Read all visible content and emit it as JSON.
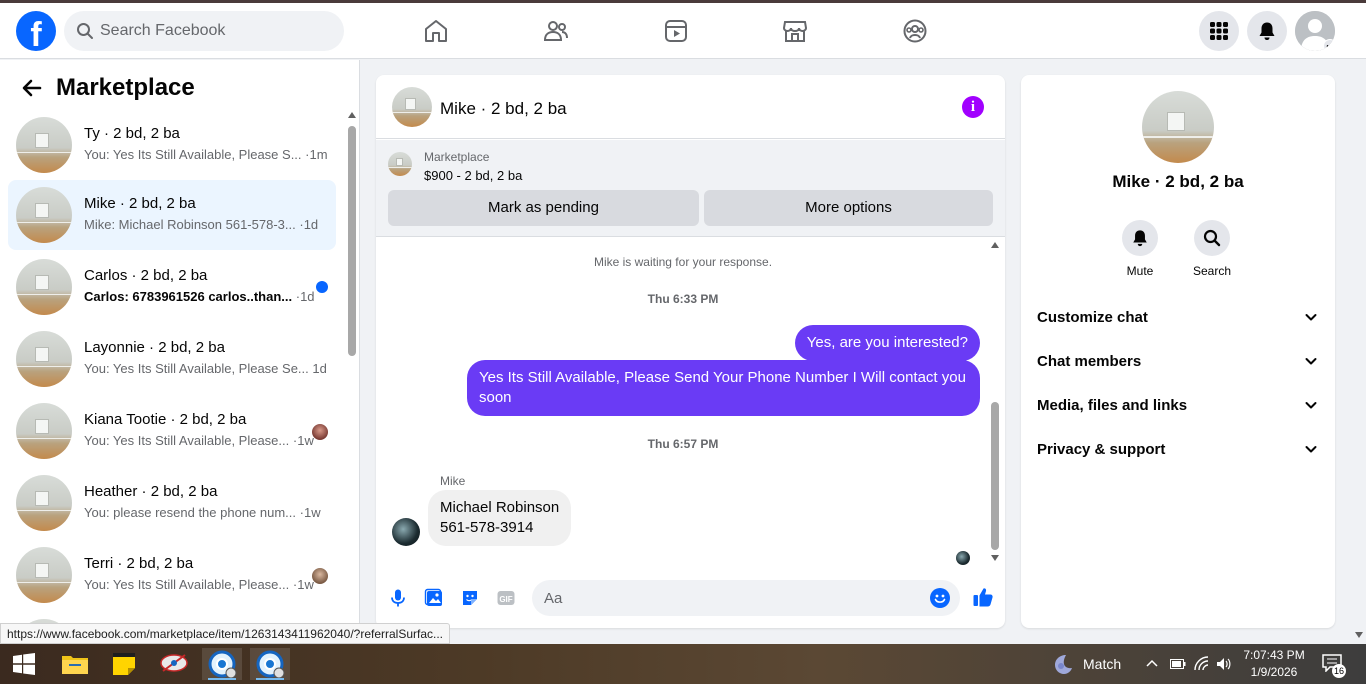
{
  "colors": {
    "brand": "#0866ff",
    "outgoing_bubble": "#6a3bf5",
    "info_accent": "#a100ff",
    "active_row": "#ebf5ff"
  },
  "topbar": {
    "logo_glyph": "f",
    "search_placeholder": "Search Facebook",
    "nav_icons": [
      "home-icon",
      "friends-icon",
      "video-icon",
      "marketplace-icon",
      "groups-icon"
    ],
    "right_icons": [
      "menu-grid-icon",
      "notifications-bell-icon",
      "account-avatar"
    ]
  },
  "sidebar": {
    "title": "Marketplace",
    "conversations": [
      {
        "name": "Ty · 2 bd, 2 ba",
        "preview": "You: Yes Its Still Available, Please S...",
        "time": "·1m",
        "status": "none"
      },
      {
        "name": "Mike · 2 bd, 2 ba",
        "preview": "Mike: Michael Robinson 561-578-3...",
        "time": "·1d",
        "status": "none"
      },
      {
        "name": "Carlos · 2 bd, 2 ba",
        "preview": "Carlos: 6783961526 carlos..than...",
        "time": "·1d",
        "status": "unread-dot"
      },
      {
        "name": "Layonnie · 2 bd, 2 ba",
        "preview": "You: Yes Its Still Available, Please Se...",
        "time": "1d",
        "status": "none"
      },
      {
        "name": "Kiana Tootie · 2 bd, 2 ba",
        "preview": "You: Yes Its Still Available, Please...",
        "time": "·1w",
        "status": "seen-avatar"
      },
      {
        "name": "Heather · 2 bd, 2 ba",
        "preview": "You: please resend the phone num...",
        "time": "·1w",
        "status": "none"
      },
      {
        "name": "Terri · 2 bd, 2 ba",
        "preview": "You: Yes Its Still Available, Please...",
        "time": "·1w",
        "status": "seen-avatar"
      }
    ]
  },
  "chat": {
    "title": "Mike · 2 bd, 2 ba",
    "listing": {
      "label": "Marketplace",
      "price": "$900 - 2 bd, 2 ba",
      "mark_pending": "Mark as pending",
      "more_options": "More options"
    },
    "system_message": "Mike is waiting for your response.",
    "time1": "Thu 6:33 PM",
    "out1": "Yes, are you interested?",
    "out2": "Yes Its Still Available, Please Send Your Phone Number I Will contact you soon",
    "time2": "Thu 6:57 PM",
    "sender_name": "Mike",
    "in1": "Michael Robinson\n561-578-3914",
    "composer_placeholder": "Aa",
    "composer_icons": [
      "microphone-icon",
      "photo-icon",
      "sticker-icon",
      "gif-icon",
      "emoji-icon",
      "thumbs-up-icon"
    ]
  },
  "info_panel": {
    "name": "Mike · 2 bd, 2 ba",
    "mute_label": "Mute",
    "search_label": "Search",
    "sections": [
      "Customize chat",
      "Chat members",
      "Media, files and links",
      "Privacy & support"
    ]
  },
  "status_url": "https://www.facebook.com/marketplace/item/1263143411962040/?referralSurfac...",
  "taskbar": {
    "weather_label": "Match",
    "time": "7:07:43 PM",
    "date": "1/9/2026",
    "notification_count": "16"
  }
}
